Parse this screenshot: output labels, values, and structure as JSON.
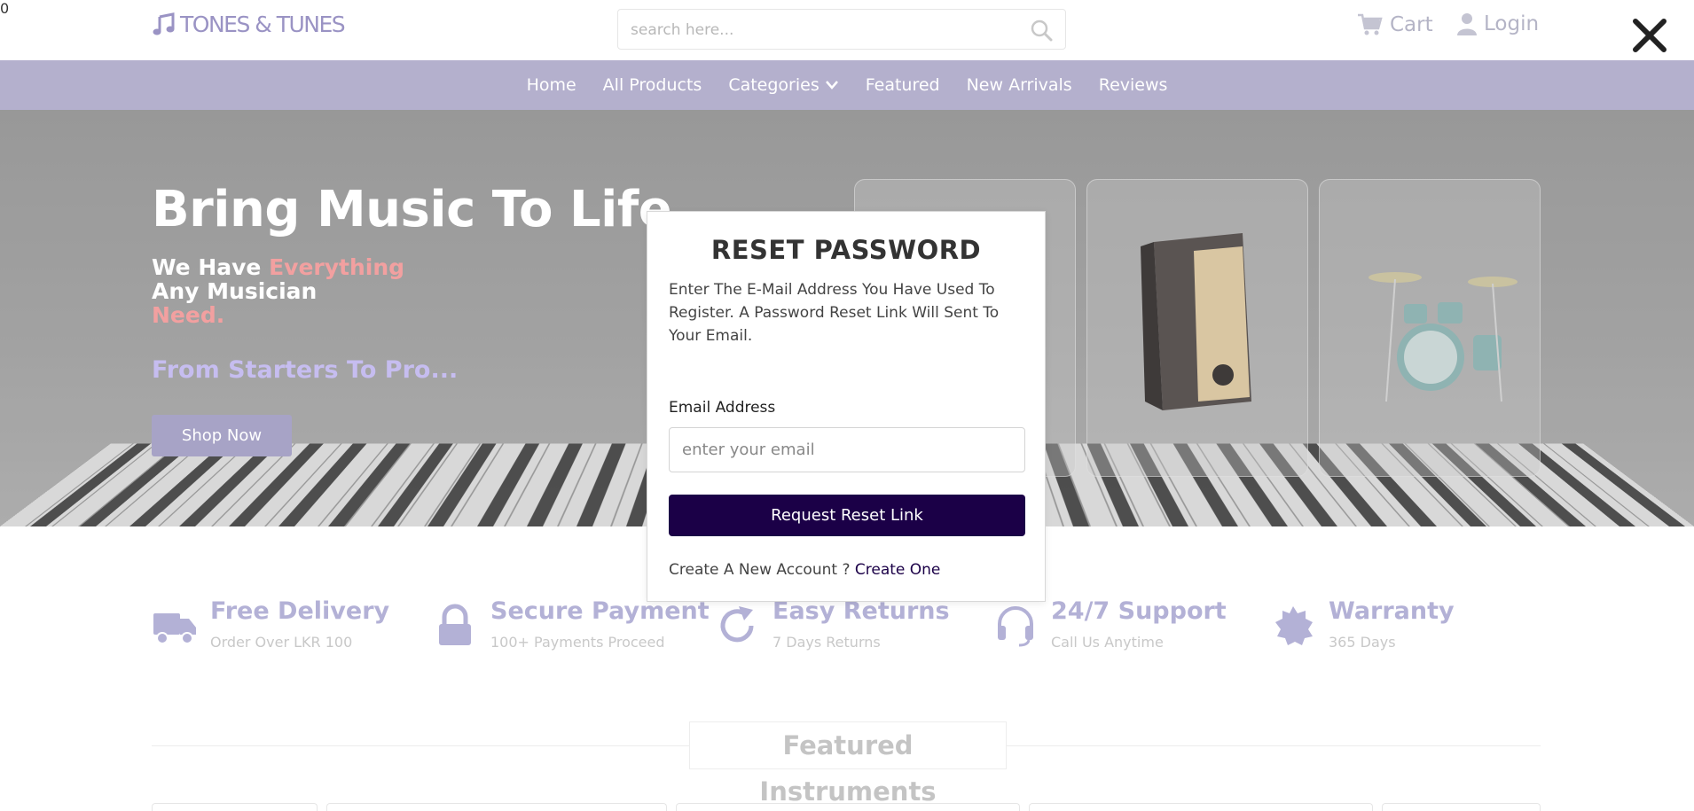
{
  "brand": {
    "name": "TONES & TUNES"
  },
  "search": {
    "placeholder": "search here..."
  },
  "header": {
    "cart_label": "Cart",
    "cart_count": "0",
    "login_label": "Login"
  },
  "nav": {
    "items": [
      "Home",
      "All Products",
      "Categories",
      "Featured",
      "New Arrivals",
      "Reviews"
    ]
  },
  "hero": {
    "title": "Bring Music To Life",
    "subtitle_part1": "We Have ",
    "subtitle_highlight1": "Everything",
    "subtitle_part2": "Any Musician",
    "subtitle_highlight2": "Need.",
    "tagline": "From Starters To Pro...",
    "shop_button": "Shop Now",
    "accent_color": "#f2a0a0"
  },
  "features": [
    {
      "icon": "truck-icon",
      "title": "Free Delivery",
      "subtitle": "Order Over LKR 100"
    },
    {
      "icon": "lock-icon",
      "title": "Secure Payment",
      "subtitle": "100+ Payments Proceed"
    },
    {
      "icon": "refresh-icon",
      "title": "Easy Returns",
      "subtitle": "7 Days Returns"
    },
    {
      "icon": "headset-icon",
      "title": "24/7 Support",
      "subtitle": "Call Us Anytime"
    },
    {
      "icon": "badge-icon",
      "title": "Warranty",
      "subtitle": "365 Days"
    }
  ],
  "featured_section": {
    "title": "Featured Instruments"
  },
  "modal": {
    "title": "RESET PASSWORD",
    "description": "Enter The E-Mail Address You Have Used To Register. A Password Reset Link Will Sent To Your Email.",
    "email_label": "Email Address",
    "email_placeholder": "enter your email",
    "email_value": "",
    "submit_label": "Request Reset Link",
    "create_prompt": "Create A New Account ?",
    "create_link": "Create One",
    "button_color": "#1b0047"
  },
  "colors": {
    "nav_bg": "#b4b0cd",
    "brand": "#9a93c4"
  }
}
